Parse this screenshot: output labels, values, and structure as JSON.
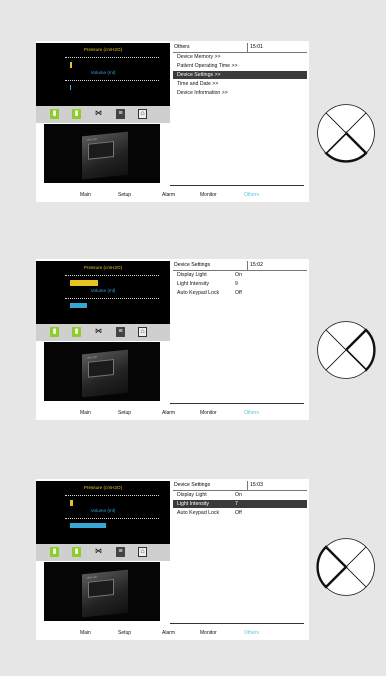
{
  "accent_colors": {
    "pressure": "#e6c31f",
    "volume": "#35a8d6",
    "nav_active": "#59c6df",
    "icon_green": "#8ccd2a"
  },
  "gauge": {
    "pressure_label": "Pressure (cmH2O)",
    "volume_label": "Volume (ml)"
  },
  "nav": [
    "Main",
    "Setup",
    "Alarm",
    "Monitor",
    "Others"
  ],
  "device_image": {
    "label": "vivo 60"
  },
  "screens": [
    {
      "title": "Others",
      "time": "15:01",
      "items": [
        {
          "label": "Device Memory >>",
          "value": ""
        },
        {
          "label": "Patient Operating Time >>",
          "value": ""
        },
        {
          "label": "Device Settings >>",
          "value": ""
        },
        {
          "label": "Time and Date >>",
          "value": ""
        },
        {
          "label": "Device Information >>",
          "value": ""
        }
      ],
      "selected_index": 2,
      "pressure_level": 0.02,
      "volume_level": 0.0,
      "dpad_pressed": "down"
    },
    {
      "title": "Device Settings",
      "time": "15:02",
      "items": [
        {
          "label": "Display Light",
          "value": "On"
        },
        {
          "label": "Light Intensity",
          "value": "9"
        },
        {
          "label": "Auto Keypad Lock",
          "value": "Off"
        }
      ],
      "selected_index": -1,
      "pressure_level": 0.32,
      "volume_level": 0.2,
      "dpad_pressed": "right"
    },
    {
      "title": "Device Settings",
      "time": "15:03",
      "items": [
        {
          "label": "Display Light",
          "value": "On"
        },
        {
          "label": "Light Intensity",
          "value": "7"
        },
        {
          "label": "Auto Keypad Lock",
          "value": "Off"
        }
      ],
      "selected_index": 1,
      "pressure_level": 0.03,
      "volume_level": 0.42,
      "dpad_pressed": "left"
    }
  ]
}
